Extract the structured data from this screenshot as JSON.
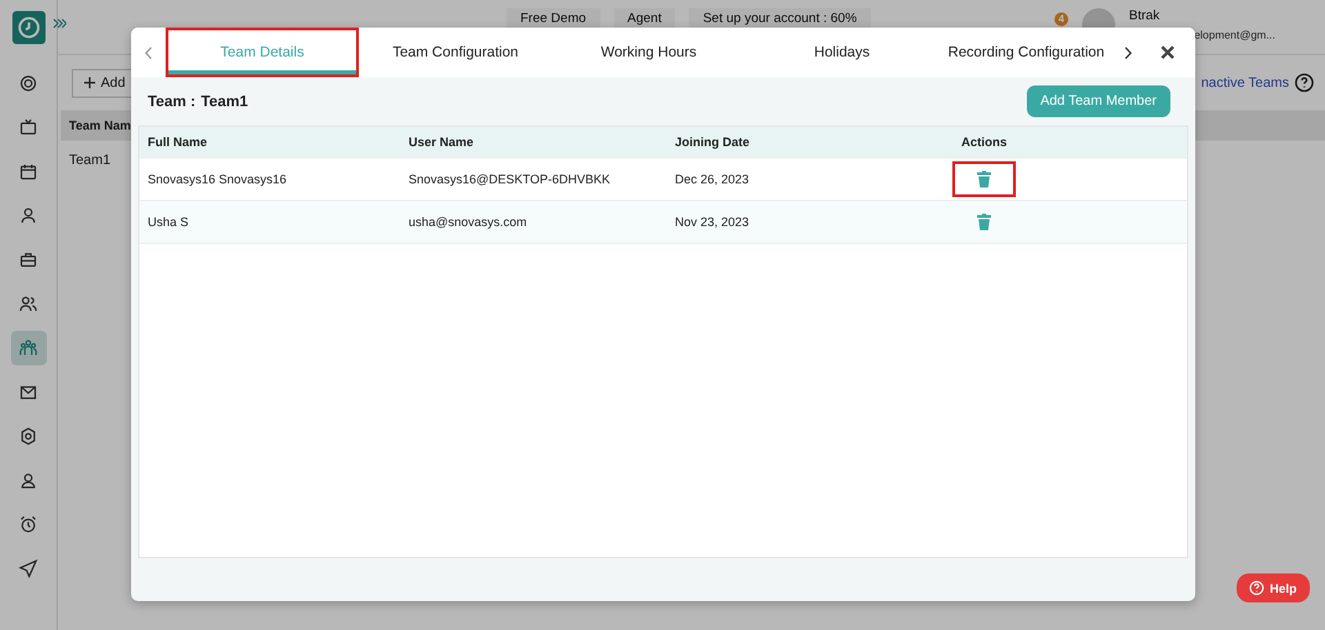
{
  "topbar": {
    "free_demo": "Free Demo",
    "agent": "Agent",
    "setup": "Set up your account : 60%",
    "notification_count": "4",
    "user_name": "Btrak",
    "user_email": "elopment@gm..."
  },
  "sidebar": {
    "items": [
      {
        "selected": false
      },
      {
        "selected": false
      },
      {
        "selected": false
      },
      {
        "selected": false
      },
      {
        "selected": false
      },
      {
        "selected": false
      },
      {
        "selected": true
      },
      {
        "selected": false
      },
      {
        "selected": false
      },
      {
        "selected": false
      },
      {
        "selected": false
      },
      {
        "selected": false
      }
    ]
  },
  "page": {
    "add_button": "Add",
    "inactive_link": "nactive Teams",
    "column_1": "Team Nam",
    "rows": [
      "Team1"
    ]
  },
  "modal": {
    "tabs": [
      {
        "label": "Team Details",
        "selected": true,
        "highlighted": true
      },
      {
        "label": "Team Configuration",
        "selected": false,
        "highlighted": false
      },
      {
        "label": "Working Hours",
        "selected": false,
        "highlighted": false
      },
      {
        "label": "Holidays",
        "selected": false,
        "highlighted": false
      },
      {
        "label": "Recording Configuration",
        "selected": false,
        "highlighted": false
      }
    ],
    "team_label": "Team :",
    "team_name": "Team1",
    "add_member_button": "Add Team Member",
    "columns": [
      "Full Name",
      "User Name",
      "Joining Date",
      "Actions"
    ],
    "rows": [
      {
        "full_name": "Snovasys16 Snovasys16",
        "user_name": "Snovasys16@DESKTOP-6DHVBKK",
        "joining_date": "Dec 26, 2023",
        "highlighted": true
      },
      {
        "full_name": "Usha S",
        "user_name": "usha@snovasys.com",
        "joining_date": "Nov 23, 2023",
        "highlighted": false
      }
    ]
  },
  "help_button": "Help"
}
